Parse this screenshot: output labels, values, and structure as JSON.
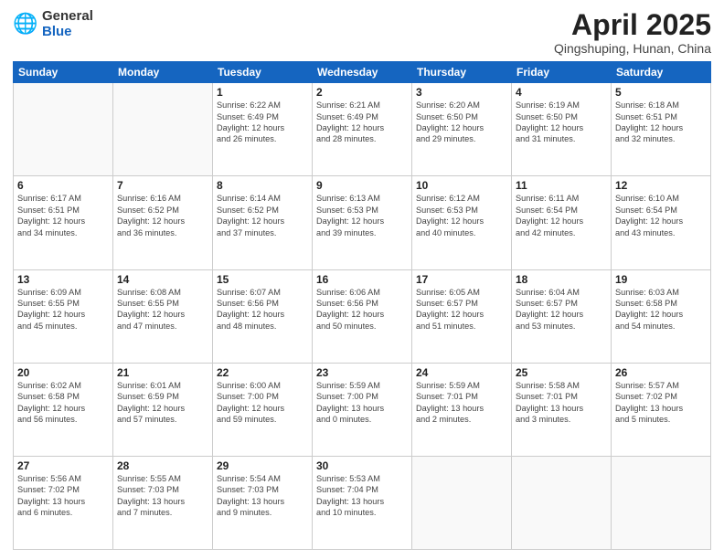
{
  "header": {
    "logo_general": "General",
    "logo_blue": "Blue",
    "title": "April 2025",
    "subtitle": "Qingshuping, Hunan, China"
  },
  "weekdays": [
    "Sunday",
    "Monday",
    "Tuesday",
    "Wednesday",
    "Thursday",
    "Friday",
    "Saturday"
  ],
  "weeks": [
    [
      {
        "day": "",
        "info": ""
      },
      {
        "day": "",
        "info": ""
      },
      {
        "day": "1",
        "info": "Sunrise: 6:22 AM\nSunset: 6:49 PM\nDaylight: 12 hours\nand 26 minutes."
      },
      {
        "day": "2",
        "info": "Sunrise: 6:21 AM\nSunset: 6:49 PM\nDaylight: 12 hours\nand 28 minutes."
      },
      {
        "day": "3",
        "info": "Sunrise: 6:20 AM\nSunset: 6:50 PM\nDaylight: 12 hours\nand 29 minutes."
      },
      {
        "day": "4",
        "info": "Sunrise: 6:19 AM\nSunset: 6:50 PM\nDaylight: 12 hours\nand 31 minutes."
      },
      {
        "day": "5",
        "info": "Sunrise: 6:18 AM\nSunset: 6:51 PM\nDaylight: 12 hours\nand 32 minutes."
      }
    ],
    [
      {
        "day": "6",
        "info": "Sunrise: 6:17 AM\nSunset: 6:51 PM\nDaylight: 12 hours\nand 34 minutes."
      },
      {
        "day": "7",
        "info": "Sunrise: 6:16 AM\nSunset: 6:52 PM\nDaylight: 12 hours\nand 36 minutes."
      },
      {
        "day": "8",
        "info": "Sunrise: 6:14 AM\nSunset: 6:52 PM\nDaylight: 12 hours\nand 37 minutes."
      },
      {
        "day": "9",
        "info": "Sunrise: 6:13 AM\nSunset: 6:53 PM\nDaylight: 12 hours\nand 39 minutes."
      },
      {
        "day": "10",
        "info": "Sunrise: 6:12 AM\nSunset: 6:53 PM\nDaylight: 12 hours\nand 40 minutes."
      },
      {
        "day": "11",
        "info": "Sunrise: 6:11 AM\nSunset: 6:54 PM\nDaylight: 12 hours\nand 42 minutes."
      },
      {
        "day": "12",
        "info": "Sunrise: 6:10 AM\nSunset: 6:54 PM\nDaylight: 12 hours\nand 43 minutes."
      }
    ],
    [
      {
        "day": "13",
        "info": "Sunrise: 6:09 AM\nSunset: 6:55 PM\nDaylight: 12 hours\nand 45 minutes."
      },
      {
        "day": "14",
        "info": "Sunrise: 6:08 AM\nSunset: 6:55 PM\nDaylight: 12 hours\nand 47 minutes."
      },
      {
        "day": "15",
        "info": "Sunrise: 6:07 AM\nSunset: 6:56 PM\nDaylight: 12 hours\nand 48 minutes."
      },
      {
        "day": "16",
        "info": "Sunrise: 6:06 AM\nSunset: 6:56 PM\nDaylight: 12 hours\nand 50 minutes."
      },
      {
        "day": "17",
        "info": "Sunrise: 6:05 AM\nSunset: 6:57 PM\nDaylight: 12 hours\nand 51 minutes."
      },
      {
        "day": "18",
        "info": "Sunrise: 6:04 AM\nSunset: 6:57 PM\nDaylight: 12 hours\nand 53 minutes."
      },
      {
        "day": "19",
        "info": "Sunrise: 6:03 AM\nSunset: 6:58 PM\nDaylight: 12 hours\nand 54 minutes."
      }
    ],
    [
      {
        "day": "20",
        "info": "Sunrise: 6:02 AM\nSunset: 6:58 PM\nDaylight: 12 hours\nand 56 minutes."
      },
      {
        "day": "21",
        "info": "Sunrise: 6:01 AM\nSunset: 6:59 PM\nDaylight: 12 hours\nand 57 minutes."
      },
      {
        "day": "22",
        "info": "Sunrise: 6:00 AM\nSunset: 7:00 PM\nDaylight: 12 hours\nand 59 minutes."
      },
      {
        "day": "23",
        "info": "Sunrise: 5:59 AM\nSunset: 7:00 PM\nDaylight: 13 hours\nand 0 minutes."
      },
      {
        "day": "24",
        "info": "Sunrise: 5:59 AM\nSunset: 7:01 PM\nDaylight: 13 hours\nand 2 minutes."
      },
      {
        "day": "25",
        "info": "Sunrise: 5:58 AM\nSunset: 7:01 PM\nDaylight: 13 hours\nand 3 minutes."
      },
      {
        "day": "26",
        "info": "Sunrise: 5:57 AM\nSunset: 7:02 PM\nDaylight: 13 hours\nand 5 minutes."
      }
    ],
    [
      {
        "day": "27",
        "info": "Sunrise: 5:56 AM\nSunset: 7:02 PM\nDaylight: 13 hours\nand 6 minutes."
      },
      {
        "day": "28",
        "info": "Sunrise: 5:55 AM\nSunset: 7:03 PM\nDaylight: 13 hours\nand 7 minutes."
      },
      {
        "day": "29",
        "info": "Sunrise: 5:54 AM\nSunset: 7:03 PM\nDaylight: 13 hours\nand 9 minutes."
      },
      {
        "day": "30",
        "info": "Sunrise: 5:53 AM\nSunset: 7:04 PM\nDaylight: 13 hours\nand 10 minutes."
      },
      {
        "day": "",
        "info": ""
      },
      {
        "day": "",
        "info": ""
      },
      {
        "day": "",
        "info": ""
      }
    ]
  ]
}
